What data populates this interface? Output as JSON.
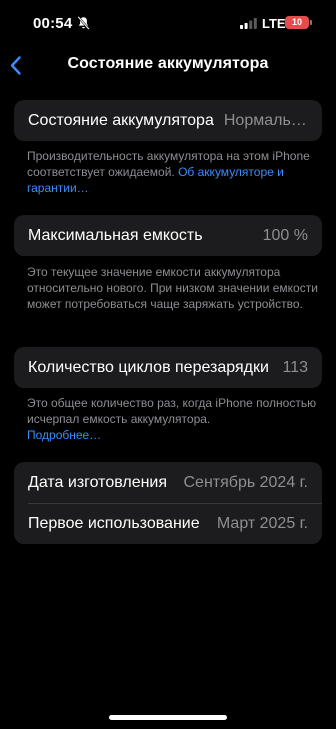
{
  "status_bar": {
    "time": "00:54",
    "network": "LTE",
    "battery_level": "10",
    "battery_color": "#e74c4c"
  },
  "nav": {
    "back_icon": "chevron-left-icon",
    "title": "Состояние аккумулятора"
  },
  "health": {
    "label": "Состояние аккумулятора",
    "value": "Нормальное",
    "footnote_text": "Производительность аккумулятора на этом iPhone соответствует ожидаемой. ",
    "footnote_link": "Об аккумуляторе и гарантии…"
  },
  "capacity": {
    "label": "Максимальная емкость",
    "value": "100 %",
    "footnote_text": "Это текущее значение емкости аккумулятора относительно нового. При низком значении емкости может потребоваться чаще заряжать устройство."
  },
  "cycles": {
    "label": "Количество циклов перезарядки",
    "value": "113",
    "footnote_text": "Это общее количество раз, когда iPhone полностью исчерпал емкость аккумулятора.",
    "footnote_link": "Подробнее…"
  },
  "dates": {
    "manufacture_label": "Дата изготовления",
    "manufacture_value": "Сентябрь 2024 г.",
    "first_use_label": "Первое использование",
    "first_use_value": "Март 2025 г."
  },
  "colors": {
    "accent": "#3a8cff",
    "background": "#000000",
    "group_background": "#1c1c1e",
    "secondary_text": "#8e8e93"
  }
}
